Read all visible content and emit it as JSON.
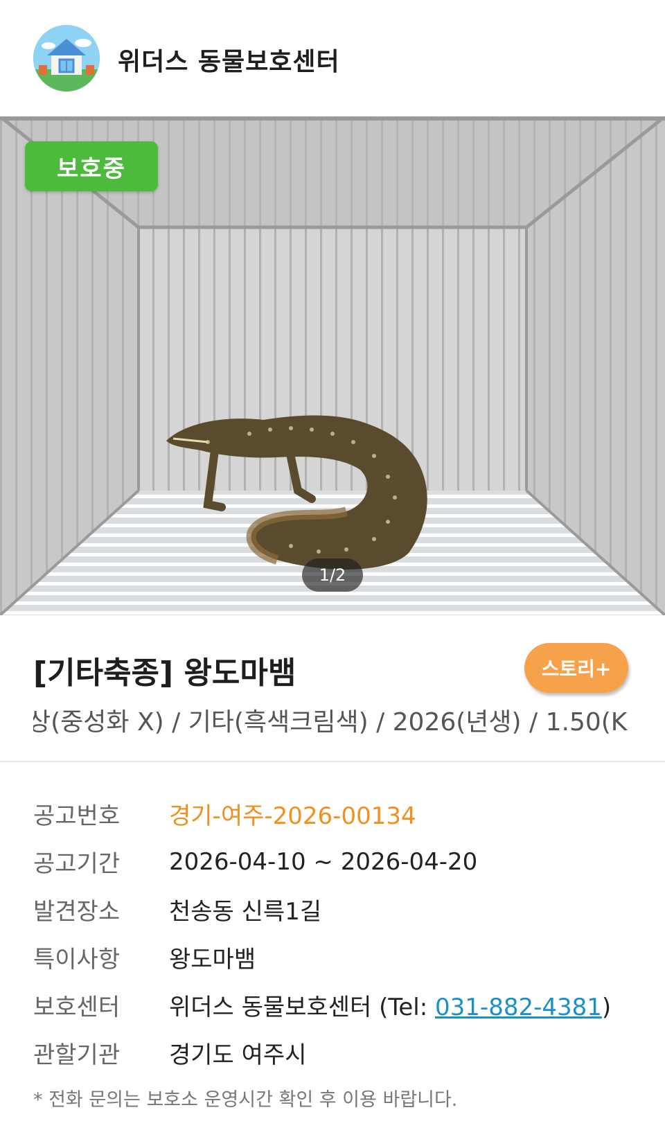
{
  "header": {
    "shelter_name": "위더스 동물보호센터",
    "logo_icon": "house-logo-icon"
  },
  "photo": {
    "status_badge": "보호중",
    "page_indicator": "1/2",
    "badge_color": "#4cbb3c"
  },
  "animal": {
    "title": "[기타축종] 왕도마뱀",
    "story_button": "스토리+",
    "summary": "상(중성화 X) / 기타(흑색크림색) / 2026(년생) / 1.50(K"
  },
  "info": {
    "notice_no_label": "공고번호",
    "notice_no": "경기-여주-2026-00134",
    "period_label": "공고기간",
    "period": "2026-04-10 ~ 2026-04-20",
    "place_label": "발견장소",
    "place": "천송동 신륵1길",
    "feature_label": "특이사항",
    "feature": "왕도마뱀",
    "center_label": "보호센터",
    "center_name": "위더스 동물보호센터 (Tel: ",
    "center_phone": "031-882-4381",
    "center_close": ")",
    "authority_label": "관할기관",
    "authority": "경기도 여주시"
  },
  "disclaimer": "* 전화 문의는 보호소 운영시간 확인 후 이용 바랍니다.",
  "colors": {
    "accent_orange": "#f0901e",
    "story_button": "#f6a24a",
    "link_blue": "#1a8fc9"
  }
}
